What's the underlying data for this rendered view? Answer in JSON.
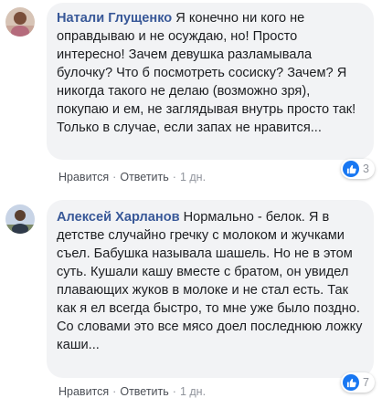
{
  "comments": [
    {
      "author": "Натали Глущенко",
      "text": "Я конечно ни кого не оправдываю и не осуждаю, но! Просто интересно! Зачем девушка разламывала булочку? Что б посмотреть сосиску? Зачем? Я никогда такого не делаю (возможно зря), покупаю и ем, не заглядывая внутрь просто так! Только в случае, если запах не нравится...",
      "actions": {
        "like": "Нравится",
        "reply": "Ответить",
        "time": "1 дн."
      },
      "reactions": {
        "icon": "like-icon",
        "count": "3"
      }
    },
    {
      "author": "Алексей Харланов",
      "text": "Нормально - белок. Я в детстве случайно гречку с молоком и жучками съел. Бабушка называла шашель. Но не в этом суть. Кушали кашу вместе с братом, он увидел плавающих жуков в молоке и не стал есть. Так как я ел всегда быстро, то мне уже было поздно. Со словами это все мясо доел последнюю ложку каши...",
      "actions": {
        "like": "Нравится",
        "reply": "Ответить",
        "time": "1 дн."
      },
      "reactions": {
        "icon": "like-icon",
        "count": "7"
      }
    }
  ],
  "separator": "·",
  "colors": {
    "author": "#385898",
    "bubble": "#f2f3f5",
    "like": "#1877f2"
  }
}
